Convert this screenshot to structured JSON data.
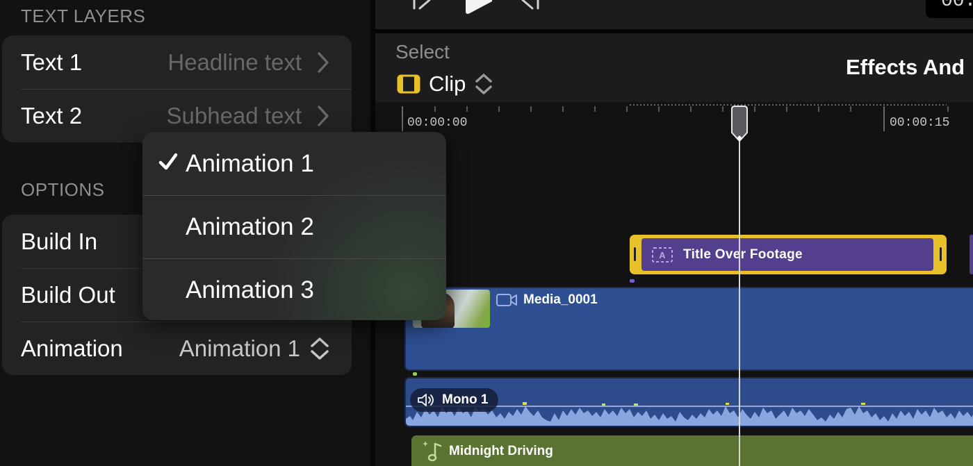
{
  "inspector": {
    "text_layers_header": "TEXT LAYERS",
    "text_layers": [
      {
        "title": "Text 1",
        "value": "Headline text"
      },
      {
        "title": "Text 2",
        "value": "Subhead text"
      }
    ],
    "options_header": "OPTIONS",
    "options": {
      "build_in": "Build In",
      "build_out": "Build Out",
      "animation_title": "Animation",
      "animation_value": "Animation 1"
    }
  },
  "dropdown": {
    "items": [
      "Animation 1",
      "Animation 2",
      "Animation 3"
    ],
    "selected_index": 0
  },
  "transport": {
    "timecode_partial": "00:"
  },
  "timeline_header": {
    "select_label": "Select",
    "clip_label": "Clip",
    "title": "Effects And"
  },
  "ruler": {
    "tc_start": "00:00:00",
    "tc_15": "00:00:15"
  },
  "clips": {
    "title_clip": "Title Over Footage",
    "video_clip": "Media_0001",
    "audio_clip": "Mono 1",
    "music_clip": "Midnight Driving"
  },
  "colors": {
    "title_clip_border": "#e8c12a",
    "title_clip_fill": "#533f8e",
    "video_clip": "#2f4f93",
    "audio_clip": "#2e4b8c",
    "waveform": "#8aa6e0",
    "music_clip": "#5a7330"
  }
}
